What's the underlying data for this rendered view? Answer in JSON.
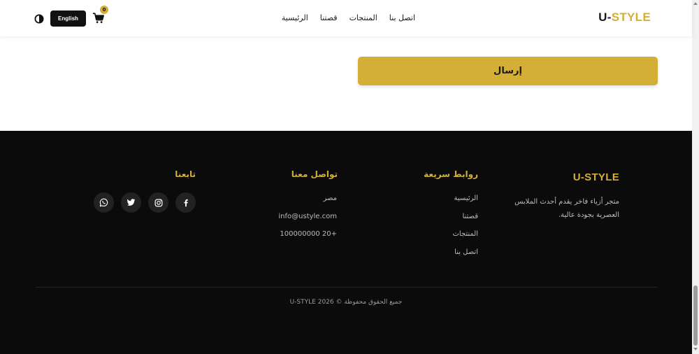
{
  "header": {
    "brand_u": "U-",
    "brand_style": "STYLE",
    "nav": [
      "الرئيسية",
      "قصتنا",
      "المنتجات",
      "اتصل بنا"
    ],
    "cart_count": "0",
    "lang_button": "English",
    "icons": {
      "cart": "shopping-cart-icon",
      "theme": "contrast-icon"
    }
  },
  "form": {
    "submit_label": "إرسال"
  },
  "footer": {
    "brand_u": "U-",
    "brand_style": "STYLE",
    "description": "متجر أزياء فاخر يقدم أحدث الملابس العصرية بجودة عالية.",
    "quick_links_title": "روابط سريعة",
    "quick_links": [
      "الرئيسية",
      "قصتنا",
      "المنتجات",
      "اتصل بنا"
    ],
    "contact_title": "تواصل معنا",
    "contact": {
      "country": "مصر",
      "email": "info@ustyle.com",
      "phone": "+20 100000000"
    },
    "follow_title": "تابعنا",
    "social": [
      "whatsapp-icon",
      "twitter-icon",
      "instagram-icon",
      "facebook-icon"
    ],
    "copyright": "جميع الحقوق محفوظة © 2026 U-STYLE"
  },
  "colors": {
    "accent": "#d4af37",
    "footer_bg": "#0b0b0b",
    "text_dark": "#1a1a1a"
  }
}
